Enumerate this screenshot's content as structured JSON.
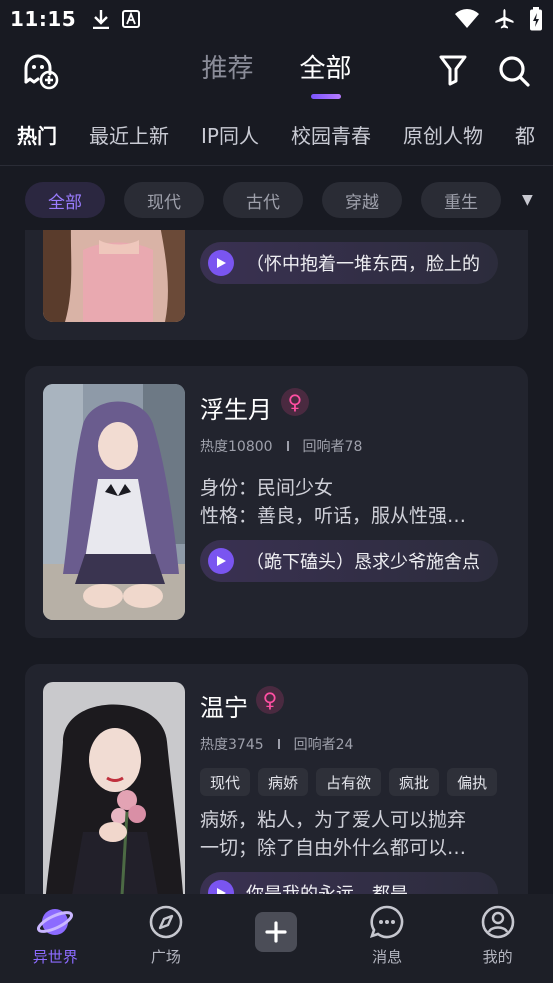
{
  "status_bar": {
    "time": "11:15"
  },
  "header": {
    "tabs": [
      "推荐",
      "全部"
    ],
    "active_tab": 1
  },
  "categories": [
    "热门",
    "最近上新",
    "IP同人",
    "校园青春",
    "原创人物",
    "都"
  ],
  "chips": [
    "全部",
    "现代",
    "古代",
    "穿越",
    "重生"
  ],
  "cards": [
    {
      "voice_text": "（怀中抱着一堆东西，脸上的"
    },
    {
      "name": "浮生月",
      "gender_icon": "female-icon",
      "heat": "热度10800",
      "responders": "回响者78",
      "desc": [
        "身份：民间少女",
        "性格：善良，听话，服从性强…"
      ],
      "voice_text": "（跪下磕头）恳求少爷施舍点"
    },
    {
      "name": "温宁",
      "gender_icon": "female-icon",
      "heat": "热度3745",
      "responders": "回响者24",
      "tags": [
        "现代",
        "病娇",
        "占有欲",
        "疯批",
        "偏执"
      ],
      "desc": [
        "病娇，粘人，为了爱人可以抛弃",
        "一切；除了自由外什么都可以…"
      ],
      "voice_text": "你是我的永远，都是"
    }
  ],
  "bottom_nav": [
    "异世界",
    "广场",
    "",
    "消息",
    "我的"
  ],
  "colors": {
    "accent": "#8c6bff",
    "background": "#181a22",
    "card": "#22242e",
    "female": "#ff4fa2"
  }
}
